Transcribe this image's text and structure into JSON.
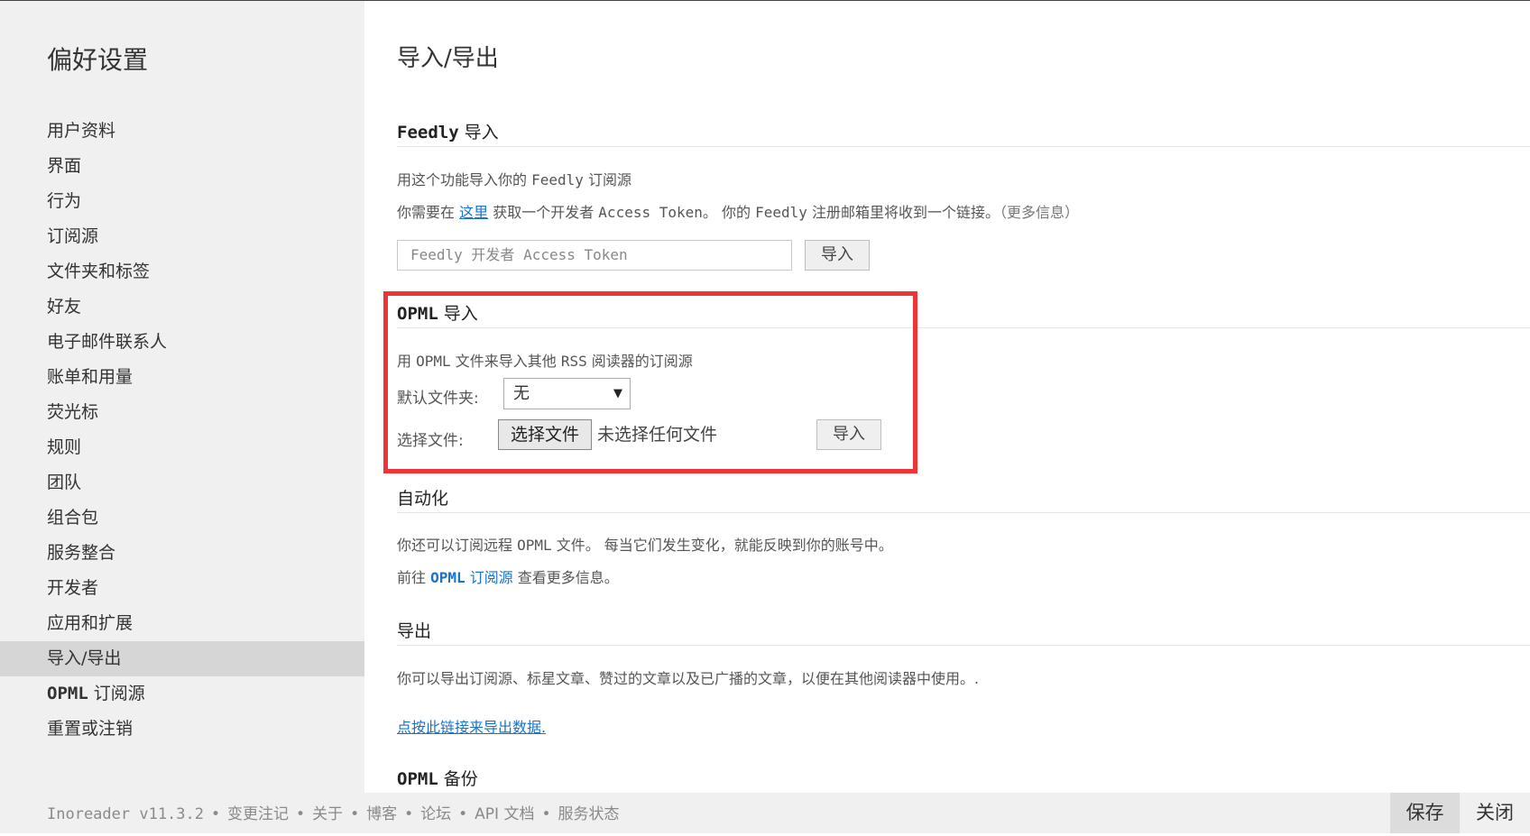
{
  "sidebar": {
    "title": "偏好设置",
    "items": [
      {
        "label": "用户资料"
      },
      {
        "label": "界面"
      },
      {
        "label": "行为"
      },
      {
        "label": "订阅源"
      },
      {
        "label": "文件夹和标签"
      },
      {
        "label": "好友"
      },
      {
        "label": "电子邮件联系人"
      },
      {
        "label": "账单和用量"
      },
      {
        "label": "荧光标"
      },
      {
        "label": "规则"
      },
      {
        "label": "团队"
      },
      {
        "label": "组合包"
      },
      {
        "label": "服务整合"
      },
      {
        "label": "开发者"
      },
      {
        "label": "应用和扩展"
      },
      {
        "label": "导入/导出",
        "active": true
      },
      {
        "label_bold": "OPML",
        "label": " 订阅源"
      },
      {
        "label": "重置或注销"
      }
    ]
  },
  "main": {
    "page_title": "导入/导出",
    "feedly": {
      "heading_bold": "Feedly",
      "heading_rest": " 导入",
      "desc1_a": "用这个功能导入你的 ",
      "desc1_m": "Feedly",
      "desc1_b": " 订阅源",
      "desc2_a": "你需要在 ",
      "desc2_link": "这里",
      "desc2_b": " 获取一个开发者 ",
      "desc2_m1": "Access Token",
      "desc2_c": "。 你的 ",
      "desc2_m2": "Feedly",
      "desc2_d": " 注册邮箱里将收到一个链接。",
      "desc2_more": "（更多信息）",
      "input_placeholder": "Feedly 开发者 Access Token",
      "import_label": "导入"
    },
    "opml_import": {
      "heading_bold": "OPML",
      "heading_rest": " 导入",
      "desc_a": "用 ",
      "desc_m1": "OPML",
      "desc_b": " 文件来导入其他 ",
      "desc_m2": "RSS",
      "desc_c": " 阅读器的订阅源",
      "folder_label": "默认文件夹:",
      "folder_value": "无",
      "file_label": "选择文件:",
      "file_button": "选择文件",
      "file_status": "未选择任何文件",
      "import_label": "导入"
    },
    "automation": {
      "heading": "自动化",
      "desc1_a": "你还可以订阅远程 ",
      "desc1_m": "OPML",
      "desc1_b": " 文件。 每当它们发生变化，就能反映到你的账号中。",
      "desc2_a": "前往 ",
      "desc2_link_bold": "OPML",
      "desc2_link_rest": " 订阅源",
      "desc2_b": " 查看更多信息。"
    },
    "export": {
      "heading": "导出",
      "desc": "你可以导出订阅源、标星文章、赞过的文章以及已广播的文章，以便在其他阅读器中使用。.",
      "link": "点按此链接来导出数据."
    },
    "opml_backup": {
      "heading_bold": "OPML",
      "heading_rest": " 备份"
    }
  },
  "footer": {
    "links": [
      "Inoreader v11.3.2",
      "变更注记",
      "关于",
      "博客",
      "论坛",
      "API 文档",
      "服务状态"
    ],
    "separator": "•",
    "save_label": "保存",
    "close_label": "关闭"
  },
  "colors": {
    "highlight": "#ee3434",
    "link": "#1a73c7",
    "sidebar_bg": "#f0f0f0"
  }
}
